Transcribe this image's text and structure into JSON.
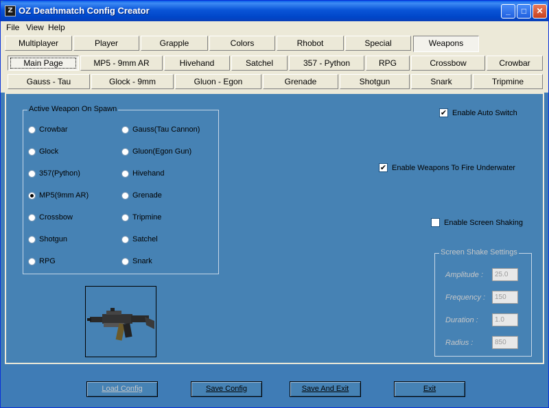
{
  "window": {
    "title": "OZ Deathmatch Config Creator",
    "app_icon_letter": "Z",
    "minimize_glyph": "_",
    "maximize_glyph": "□",
    "close_glyph": "✕"
  },
  "menu": [
    {
      "label": "File"
    },
    {
      "label": "View"
    },
    {
      "label": "Help"
    }
  ],
  "tabs_main": [
    {
      "label": "Multiplayer"
    },
    {
      "label": "Player"
    },
    {
      "label": "Grapple"
    },
    {
      "label": "Colors"
    },
    {
      "label": "Rhobot"
    },
    {
      "label": "Special"
    },
    {
      "label": "Weapons"
    }
  ],
  "tabs_weapons_row1": [
    {
      "label": "Main Page"
    },
    {
      "label": "MP5 - 9mm AR"
    },
    {
      "label": "Hivehand"
    },
    {
      "label": "Satchel"
    },
    {
      "label": "357 - Python"
    },
    {
      "label": "RPG"
    },
    {
      "label": "Crossbow"
    },
    {
      "label": "Crowbar"
    }
  ],
  "tabs_weapons_row2": [
    {
      "label": "Gauss - Tau"
    },
    {
      "label": "Glock - 9mm"
    },
    {
      "label": "Gluon - Egon"
    },
    {
      "label": "Grenade"
    },
    {
      "label": "Shotgun"
    },
    {
      "label": "Snark"
    },
    {
      "label": "Tripmine"
    }
  ],
  "spawn_group": {
    "title": "Active Weapon On Spawn",
    "col1": [
      {
        "label": "Crowbar",
        "selected": false
      },
      {
        "label": "Glock",
        "selected": false
      },
      {
        "label": "357(Python)",
        "selected": false
      },
      {
        "label": "MP5(9mm AR)",
        "selected": true
      },
      {
        "label": "Crossbow",
        "selected": false
      },
      {
        "label": "Shotgun",
        "selected": false
      },
      {
        "label": "RPG",
        "selected": false
      }
    ],
    "col2": [
      {
        "label": "Gauss(Tau Cannon)",
        "selected": false
      },
      {
        "label": "Gluon(Egon Gun)",
        "selected": false
      },
      {
        "label": "Hivehand",
        "selected": false
      },
      {
        "label": "Grenade",
        "selected": false
      },
      {
        "label": "Tripmine",
        "selected": false
      },
      {
        "label": "Satchel",
        "selected": false
      },
      {
        "label": "Snark",
        "selected": false
      }
    ]
  },
  "options": {
    "auto_switch": {
      "label": "Enable Auto Switch",
      "mark": "✔"
    },
    "underwater": {
      "label": "Enable Weapons To Fire Underwater",
      "mark": "✔"
    },
    "screen_shaking": {
      "label": "Enable Screen Shaking",
      "mark": ""
    }
  },
  "shake_group": {
    "title": "Screen Shake Settings",
    "amplitude_label": "Amplitude :",
    "amplitude": "25.0",
    "frequency_label": "Frequency :",
    "frequency": "150",
    "duration_label": "Duration :",
    "duration": "1.0",
    "radius_label": "Radius :",
    "radius": "850"
  },
  "buttons": {
    "load": "Load Config",
    "save": "Save Config",
    "save_exit": "Save And Exit",
    "exit": "Exit"
  }
}
